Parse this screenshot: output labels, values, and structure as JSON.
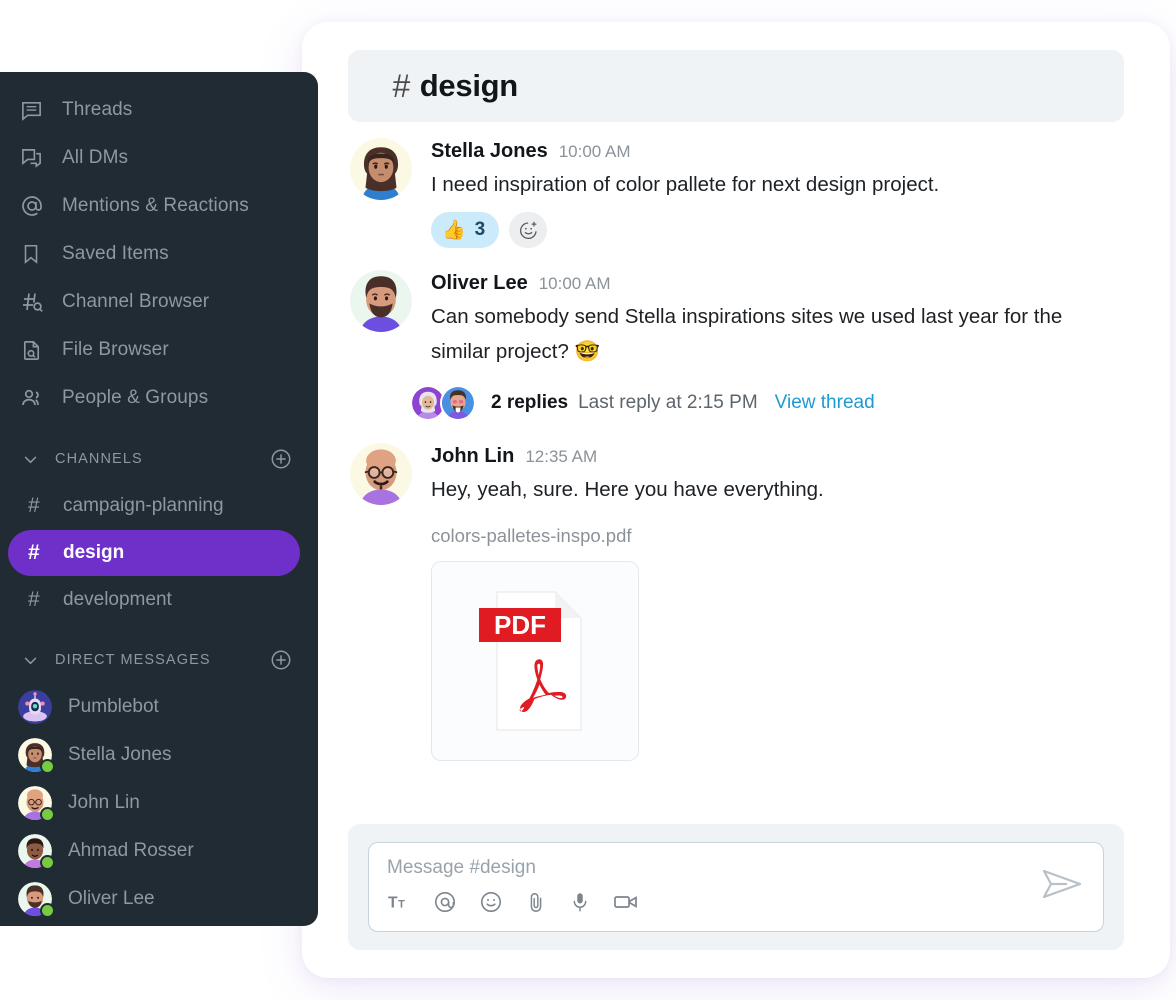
{
  "sidebar": {
    "nav": [
      {
        "label": "Threads",
        "icon": "threads-icon"
      },
      {
        "label": "All DMs",
        "icon": "all-dms-icon"
      },
      {
        "label": "Mentions & Reactions",
        "icon": "mentions-icon"
      },
      {
        "label": "Saved Items",
        "icon": "bookmark-icon"
      },
      {
        "label": "Channel Browser",
        "icon": "channel-browser-icon"
      },
      {
        "label": "File Browser",
        "icon": "file-browser-icon"
      },
      {
        "label": "People & Groups",
        "icon": "people-icon"
      }
    ],
    "channels_section": {
      "title": "CHANNELS",
      "add_label": "+"
    },
    "channels": [
      {
        "name": "campaign-planning",
        "hash": "#",
        "active": false
      },
      {
        "name": "design",
        "hash": "#",
        "active": true
      },
      {
        "name": "development",
        "hash": "#",
        "active": false
      }
    ],
    "dms_section": {
      "title": "DIRECT MESSAGES",
      "add_label": "+"
    },
    "dms": [
      {
        "name": "Pumblebot",
        "online": false,
        "avatar": "bot"
      },
      {
        "name": "Stella Jones",
        "online": true,
        "avatar": "stella"
      },
      {
        "name": "John Lin",
        "online": true,
        "avatar": "john"
      },
      {
        "name": "Ahmad Rosser",
        "online": true,
        "avatar": "ahmad"
      },
      {
        "name": "Oliver Lee",
        "online": true,
        "avatar": "oliver"
      }
    ]
  },
  "header": {
    "hash": "#",
    "channel": "design"
  },
  "messages": [
    {
      "author": "Stella Jones",
      "time": "10:00 AM",
      "text": "I need inspiration of color pallete for next design project.",
      "avatar": "stella",
      "reaction": {
        "emoji": "👍",
        "count": "3"
      }
    },
    {
      "author": "Oliver Lee",
      "time": "10:00 AM",
      "text": "Can somebody send Stella inspirations sites we used last year for the similar project? 🤓",
      "avatar": "oliver",
      "thread": {
        "count": "2 replies",
        "last_reply": "Last reply at 2:15 PM",
        "link": "View thread"
      }
    },
    {
      "author": "John Lin",
      "time": "12:35 AM",
      "text": "Hey, yeah, sure. Here you have everything.",
      "avatar": "john",
      "file": {
        "name": "colors-palletes-inspo.pdf",
        "kind": "PDF"
      }
    }
  ],
  "composer": {
    "placeholder": "Message #design",
    "tools": [
      {
        "name": "format-text-icon"
      },
      {
        "name": "mention-icon"
      },
      {
        "name": "emoji-icon"
      },
      {
        "name": "attachment-icon"
      },
      {
        "name": "microphone-icon"
      },
      {
        "name": "video-icon"
      }
    ],
    "send_label": "Send"
  },
  "colors": {
    "accent_purple": "#6f2fc9",
    "sidebar_bg": "#212b33",
    "header_bg": "#eff3f6",
    "link_blue": "#1d9bd1",
    "online_green": "#7ac943",
    "pdf_red": "#e01b22"
  }
}
